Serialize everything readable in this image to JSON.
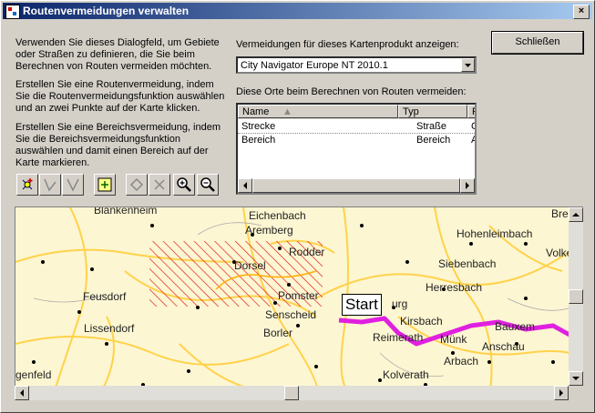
{
  "window": {
    "title": "Routenvermeidungen verwalten",
    "close_glyph": "×"
  },
  "description": {
    "p1": "Verwenden Sie dieses Dialogfeld, um Gebiete oder Straßen zu definieren, die Sie beim Berechnen von Routen vermeiden möchten.",
    "p2": "Erstellen Sie eine Routenvermeidung, indem Sie die Routenvermeidungsfunktion auswählen und an zwei Punkte auf der Karte klicken.",
    "p3": "Erstellen Sie eine Bereichsvermeidung, indem Sie die Bereichsvermeidungsfunktion auswählen und damit einen Bereich auf der Karte markieren."
  },
  "toolbar": {
    "icons": [
      "add-point-icon",
      "route-avoid-icon",
      "area-avoid-icon",
      "select-icon",
      "diamond-icon",
      "delete-icon",
      "zoom-in-icon",
      "zoom-out-icon"
    ]
  },
  "product": {
    "label": "Vermeidungen für dieses Kartenprodukt anzeigen:",
    "selected": "City Navigator Europe NT 2010.1"
  },
  "close_button": {
    "label": "Schließen"
  },
  "avoid_list": {
    "label": "Diese Orte beim Berechnen von Routen vermeiden:",
    "columns": [
      "Name",
      "Typ",
      "P"
    ],
    "rows": [
      {
        "name": "Strecke",
        "typ": "Straße",
        "p": "C"
      },
      {
        "name": "Bereich",
        "typ": "Bereich",
        "p": "A"
      }
    ]
  },
  "map": {
    "start_label": "Start",
    "places": [
      "Blankenheim",
      "Eichenbach",
      "Brei",
      "Aremberg",
      "Hohenleimbach",
      "Rodder",
      "Volkesf",
      "Siebenbach",
      "Dorsel",
      "Feusdorf",
      "Herresbach",
      "Pomster",
      "Senscheid",
      "Lissendorf",
      "Kirsbach",
      "Borler",
      "Bauxem",
      "Reimerath",
      "Münk",
      "Anschau",
      "Arbach",
      "Kolverath",
      "genfeld",
      "urg"
    ]
  },
  "colors": {
    "route": "#e020e0",
    "avoid_area": "#e02020",
    "map_bg": "#fdf6d2",
    "roads": "#f0c84a",
    "titlebar": "#0a246a"
  }
}
